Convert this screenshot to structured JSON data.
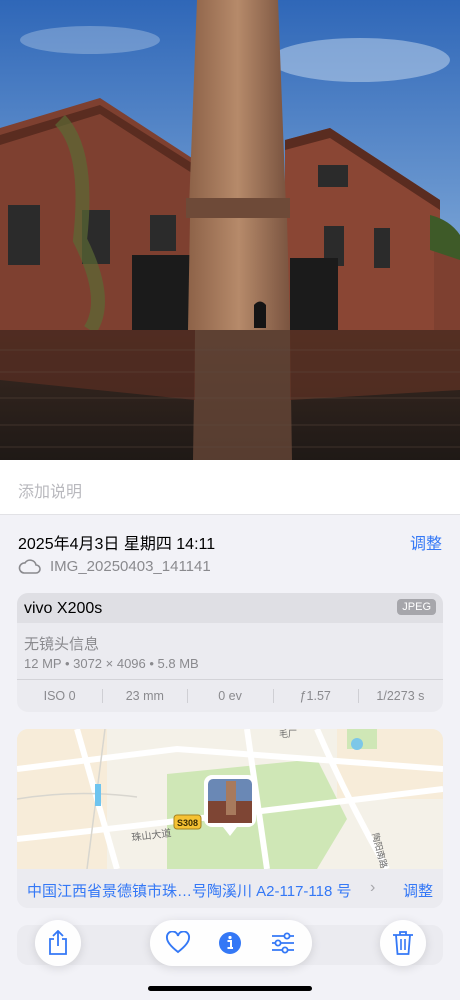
{
  "caption_placeholder": "添加说明",
  "photo_info": {
    "datetime": "2025年4月3日 星期四 14:11",
    "adjust_label": "调整",
    "filename": "IMG_20250403_141141"
  },
  "camera": {
    "model": "vivo X200s",
    "format_badge": "JPEG",
    "lens": "无镜头信息",
    "specs": "12 MP • 3072 × 4096 • 5.8 MB",
    "exif": [
      "ISO 0",
      "23 mm",
      "0 ev",
      "ƒ1.57",
      "1/2273 s"
    ]
  },
  "map": {
    "road_label": "珠山大道",
    "route_badge": "S308",
    "top_label": "毛厂",
    "side_label": "陶阳南路",
    "address": "中国江西省景德镇市珠…号陶溪川 A2-117-118 号",
    "adjust_label": "调整"
  },
  "toolbar": {
    "icons": [
      "share-icon",
      "heart-icon",
      "info-icon",
      "sliders-icon",
      "trash-icon"
    ],
    "accent": "#3478f6"
  }
}
